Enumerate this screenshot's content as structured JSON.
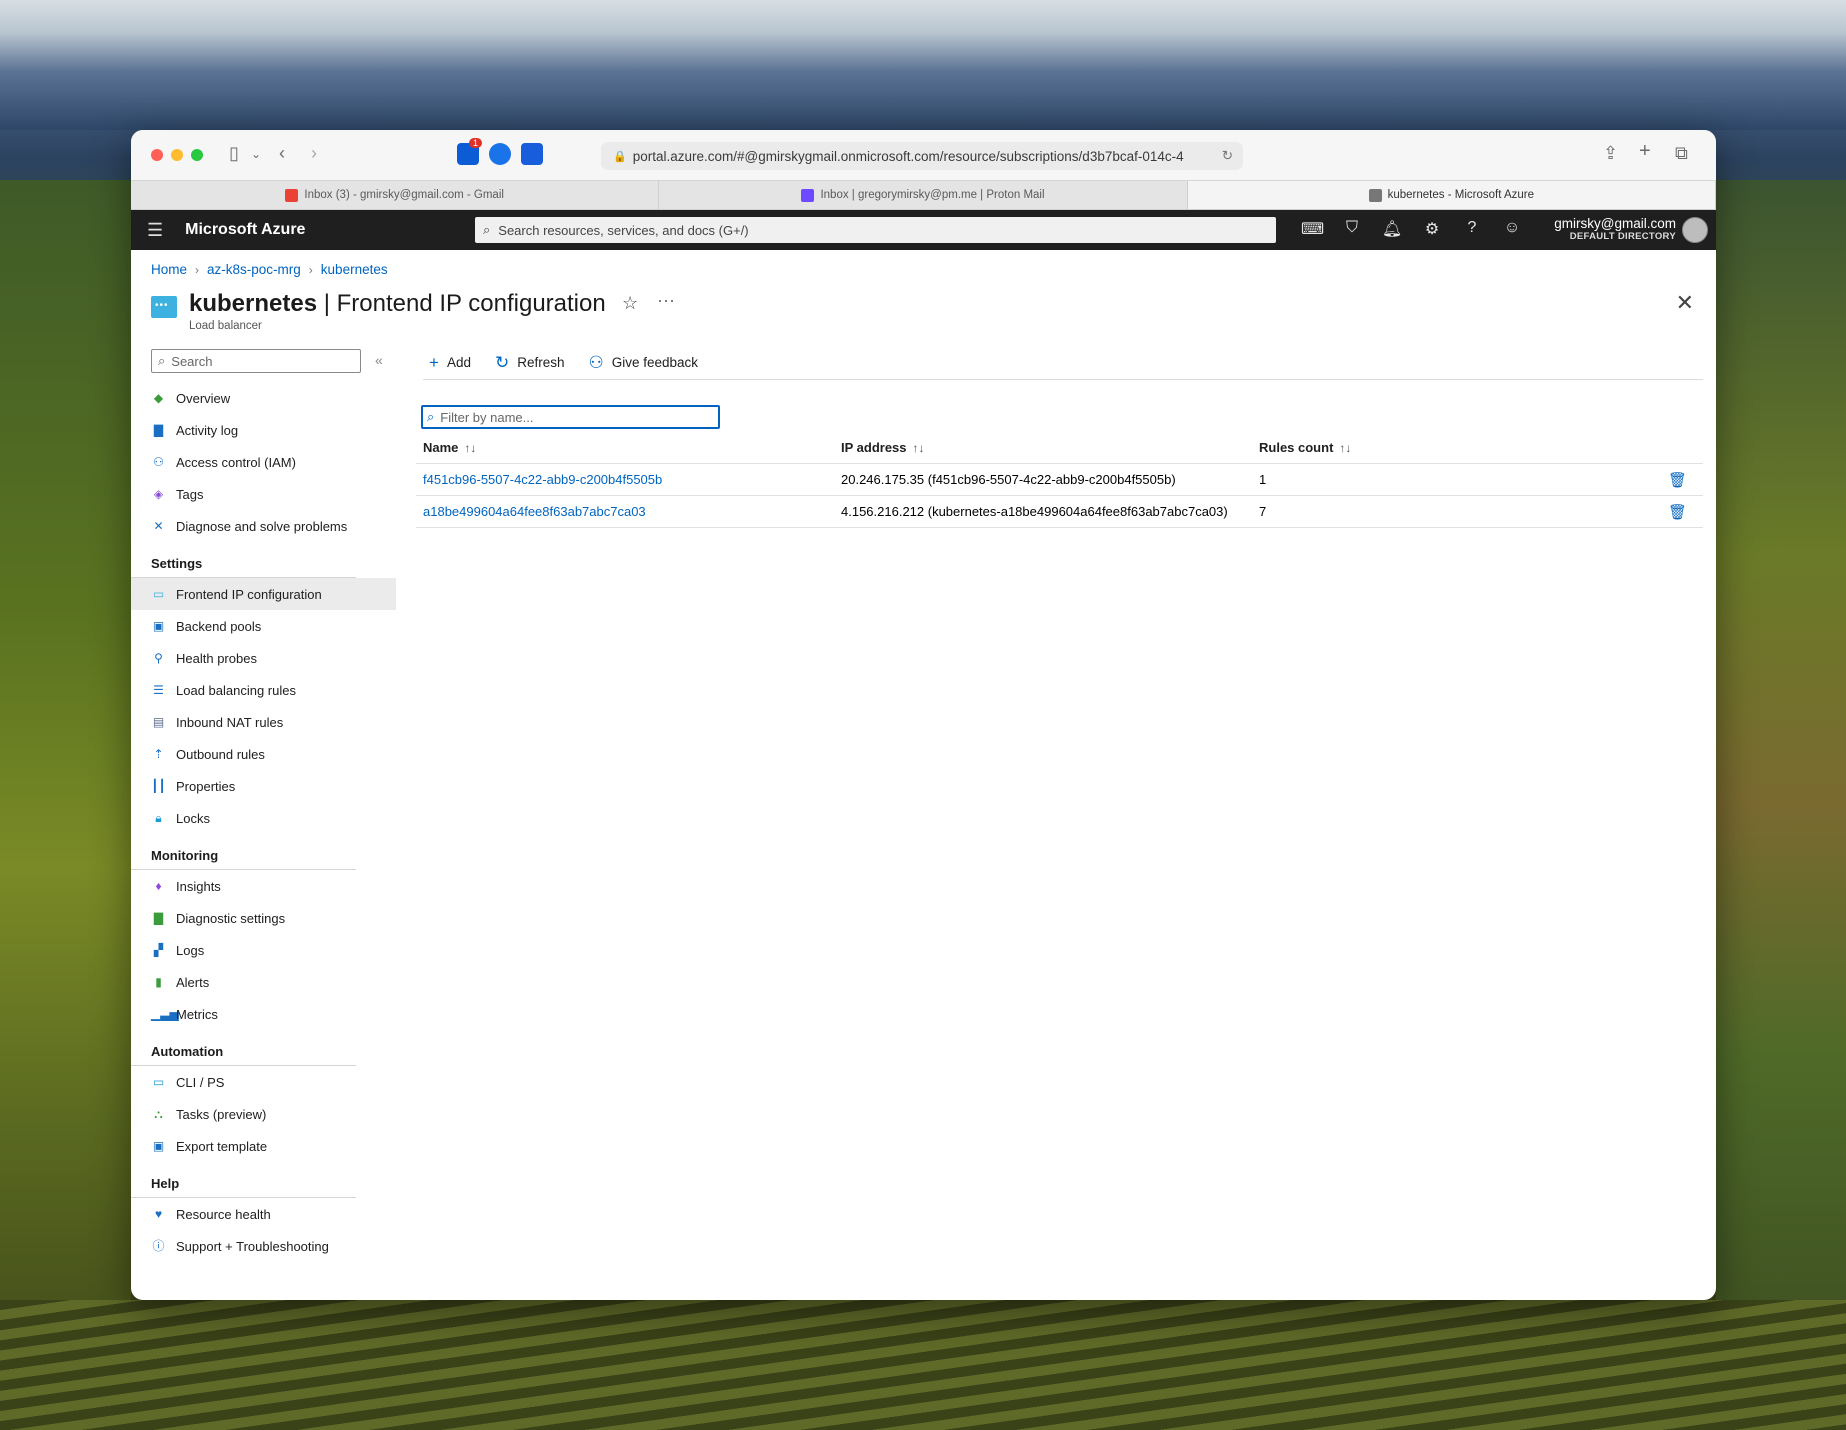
{
  "browser": {
    "url": "portal.azure.com/#@gmirskygmail.onmicrosoft.com/resource/subscriptions/d3b7bcaf-014c-4",
    "notification_badge": "1",
    "tabs": [
      {
        "label": "Inbox (3) - gmirsky@gmail.com - Gmail",
        "active": false
      },
      {
        "label": "Inbox | gregorymirsky@pm.me | Proton Mail",
        "active": false
      },
      {
        "label": "kubernetes - Microsoft Azure",
        "active": true
      }
    ]
  },
  "azure": {
    "brand": "Microsoft Azure",
    "search_placeholder": "Search resources, services, and docs (G+/)",
    "account_email": "gmirsky@gmail.com",
    "account_directory": "DEFAULT DIRECTORY"
  },
  "breadcrumb": [
    "Home",
    "az-k8s-poc-mrg",
    "kubernetes"
  ],
  "page": {
    "title_bold": "kubernetes",
    "title_rest": " | Frontend IP configuration",
    "subtitle": "Load balancer"
  },
  "sidebar": {
    "search_placeholder": "Search",
    "top_items": [
      {
        "label": "Overview",
        "icon": "overview-icon"
      },
      {
        "label": "Activity log",
        "icon": "activity-log-icon"
      },
      {
        "label": "Access control (IAM)",
        "icon": "iam-icon"
      },
      {
        "label": "Tags",
        "icon": "tag-icon"
      },
      {
        "label": "Diagnose and solve problems",
        "icon": "wrench-icon"
      }
    ],
    "sections": [
      {
        "heading": "Settings",
        "items": [
          {
            "label": "Frontend IP configuration",
            "selected": true
          },
          {
            "label": "Backend pools"
          },
          {
            "label": "Health probes"
          },
          {
            "label": "Load balancing rules"
          },
          {
            "label": "Inbound NAT rules"
          },
          {
            "label": "Outbound rules"
          },
          {
            "label": "Properties"
          },
          {
            "label": "Locks"
          }
        ]
      },
      {
        "heading": "Monitoring",
        "items": [
          {
            "label": "Insights"
          },
          {
            "label": "Diagnostic settings"
          },
          {
            "label": "Logs"
          },
          {
            "label": "Alerts"
          },
          {
            "label": "Metrics"
          }
        ]
      },
      {
        "heading": "Automation",
        "items": [
          {
            "label": "CLI / PS"
          },
          {
            "label": "Tasks (preview)"
          },
          {
            "label": "Export template"
          }
        ]
      },
      {
        "heading": "Help",
        "items": [
          {
            "label": "Resource health"
          },
          {
            "label": "Support + Troubleshooting"
          }
        ]
      }
    ]
  },
  "commands": {
    "add": "Add",
    "refresh": "Refresh",
    "feedback": "Give feedback"
  },
  "filter_placeholder": "Filter by name...",
  "table": {
    "columns": [
      "Name",
      "IP address",
      "Rules count"
    ],
    "rows": [
      {
        "name": "f451cb96-5507-4c22-abb9-c200b4f5505b",
        "ip": "20.246.175.35 (f451cb96-5507-4c22-abb9-c200b4f5505b)",
        "rules": "1"
      },
      {
        "name": "a18be499604a64fee8f63ab7abc7ca03",
        "ip": "4.156.216.212 (kubernetes-a18be499604a64fee8f63ab7abc7ca03)",
        "rules": "7"
      }
    ]
  }
}
